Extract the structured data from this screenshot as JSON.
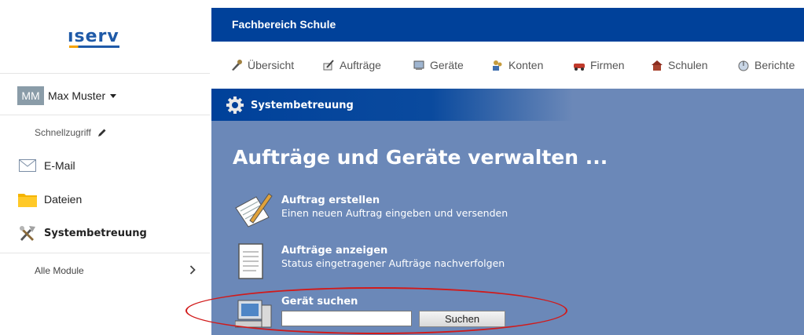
{
  "sidebar": {
    "logo": "ıserv",
    "user": {
      "initials": "MM",
      "name": "Max Muster"
    },
    "quick_access": "Schnellzugriff",
    "items": [
      {
        "label": "E-Mail",
        "icon": "envelope-icon"
      },
      {
        "label": "Dateien",
        "icon": "folder-icon"
      },
      {
        "label": "Systembetreuung",
        "icon": "tools-icon"
      }
    ],
    "all_modules": "Alle Module"
  },
  "header": {
    "title": "Fachbereich Schule"
  },
  "menu": [
    {
      "label": "Übersicht",
      "icon": "overview-icon"
    },
    {
      "label": "Aufträge",
      "icon": "orders-icon"
    },
    {
      "label": "Geräte",
      "icon": "devices-icon"
    },
    {
      "label": "Konten",
      "icon": "accounts-icon"
    },
    {
      "label": "Firmen",
      "icon": "companies-icon"
    },
    {
      "label": "Schulen",
      "icon": "schools-icon"
    },
    {
      "label": "Berichte",
      "icon": "reports-icon"
    }
  ],
  "panel": {
    "title": "Systembetreuung",
    "heading": "Aufträge und Geräte verwalten ...",
    "entries": [
      {
        "title": "Auftrag erstellen",
        "desc": "Einen neuen Auftrag eingeben und versenden"
      },
      {
        "title": "Aufträge anzeigen",
        "desc": "Status eingetragener Aufträge nachverfolgen"
      },
      {
        "title": "Gerät suchen"
      }
    ],
    "search": {
      "value": "",
      "button": "Suchen"
    }
  },
  "colors": {
    "header_blue": "#00419a",
    "panel_blue": "#6b88b8",
    "highlight_red": "#d11a1a"
  }
}
